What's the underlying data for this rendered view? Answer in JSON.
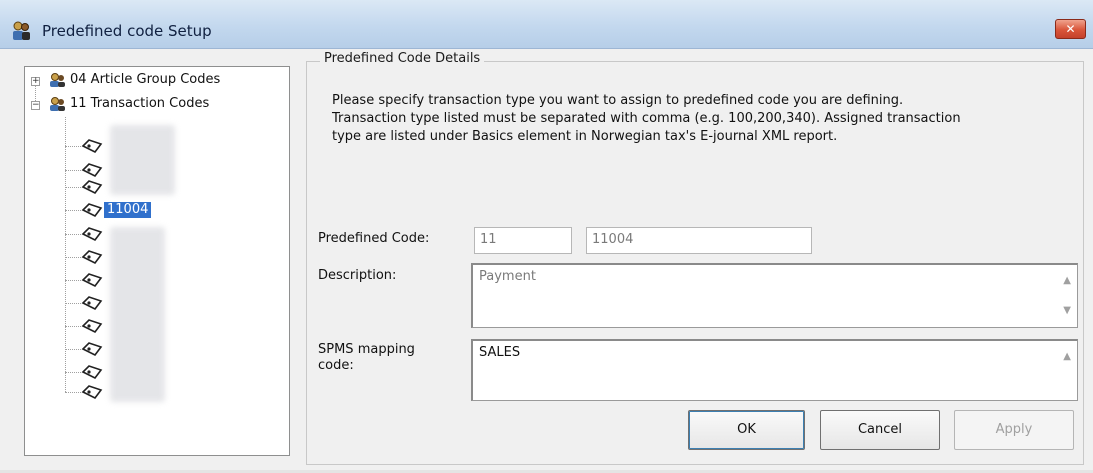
{
  "window": {
    "title": "Predefined code Setup",
    "close_label": "✕",
    "app_icon": "people-key-icon"
  },
  "tree": {
    "nodes": [
      {
        "expander": "+",
        "label": "04 Article Group Codes",
        "icon": "folder-people-icon"
      },
      {
        "expander": "−",
        "label": "11 Transaction Codes",
        "icon": "folder-people-icon"
      }
    ],
    "selected_leaf_label": "11004",
    "leaf_icon": "tag-icon"
  },
  "details": {
    "legend": "Predefined Code Details",
    "instruction_lines": [
      "Please specify transaction type you want to assign to predefined code you are defining.",
      "Transaction type listed must be separated with comma (e.g. 100,200,340). Assigned transaction",
      "type are listed under Basics element in Norwegian tax's E-journal XML report."
    ],
    "predefined_code_label": "Predefined Code:",
    "predefined_code_group": "11",
    "predefined_code_value": "11004",
    "description_label": "Description:",
    "description_value": "Payment",
    "spms_label_line1": "SPMS mapping",
    "spms_label_line2": "code:",
    "spms_value": "SALES"
  },
  "buttons": {
    "ok": "OK",
    "cancel": "Cancel",
    "apply": "Apply"
  }
}
